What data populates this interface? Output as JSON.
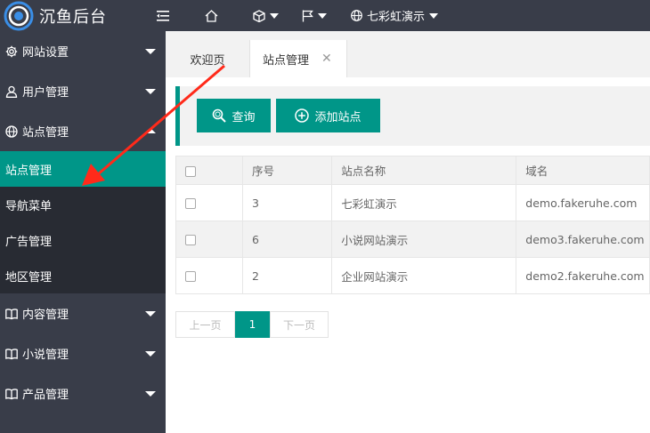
{
  "app": {
    "title": "沉鱼后台"
  },
  "header": {
    "current_site": "七彩虹演示"
  },
  "sidebar": {
    "groups": [
      {
        "label": "网站设置",
        "icon": "gear-icon"
      },
      {
        "label": "用户管理",
        "icon": "user-icon"
      },
      {
        "label": "站点管理",
        "icon": "globe-icon",
        "expanded": true,
        "children": [
          "站点管理",
          "导航菜单",
          "广告管理",
          "地区管理"
        ]
      },
      {
        "label": "内容管理",
        "icon": "book-icon"
      },
      {
        "label": "小说管理",
        "icon": "book-icon"
      },
      {
        "label": "产品管理",
        "icon": "book-icon"
      }
    ]
  },
  "tabs": {
    "home": "欢迎页",
    "active": "站点管理"
  },
  "toolbar": {
    "query": "查询",
    "add": "添加站点"
  },
  "table": {
    "headers": [
      "序号",
      "站点名称",
      "域名"
    ],
    "rows": [
      {
        "id": "3",
        "name": "七彩虹演示",
        "domain": "demo.fakeruhe.com"
      },
      {
        "id": "6",
        "name": "小说网站演示",
        "domain": "demo3.fakeruhe.com"
      },
      {
        "id": "2",
        "name": "企业网站演示",
        "domain": "demo2.fakeruhe.com"
      }
    ]
  },
  "pager": {
    "prev": "上一页",
    "current": "1",
    "next": "下一页"
  },
  "colors": {
    "accent": "#009688",
    "header_bg": "#393d49",
    "annotation_arrow": "#ff2a1a"
  }
}
